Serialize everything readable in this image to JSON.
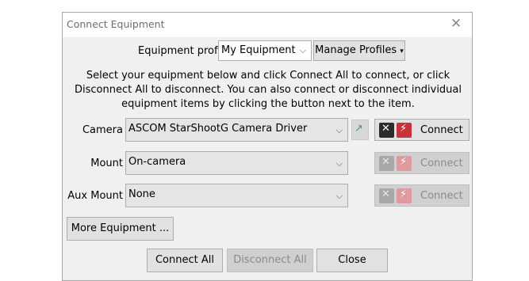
{
  "window": {
    "title": "Connect Equipment"
  },
  "profile": {
    "label": "Equipment profile",
    "selected": "My Equipment",
    "manage_label": "Manage Profiles"
  },
  "instructions": {
    "line1": "Select your equipment below and click Connect All to connect, or click",
    "line2": "Disconnect All to disconnect. You can also connect or disconnect individual",
    "line3": "equipment items by clicking the button next to the item."
  },
  "equipment": [
    {
      "label": "Camera",
      "selected": "ASCOM StarShootG Camera Driver",
      "connect_label": "Connect",
      "enabled": true
    },
    {
      "label": "Mount",
      "selected": "On-camera",
      "connect_label": "Connect",
      "enabled": false
    },
    {
      "label": "Aux Mount",
      "selected": "None",
      "connect_label": "Connect",
      "enabled": false
    }
  ],
  "more_equipment_label": "More Equipment ...",
  "footer": {
    "connect_all": "Connect All",
    "disconnect_all": "Disconnect All",
    "close": "Close"
  },
  "colors": {
    "disconnect_icon": "#c8323c",
    "setup_icon": "#2b2b2b"
  }
}
